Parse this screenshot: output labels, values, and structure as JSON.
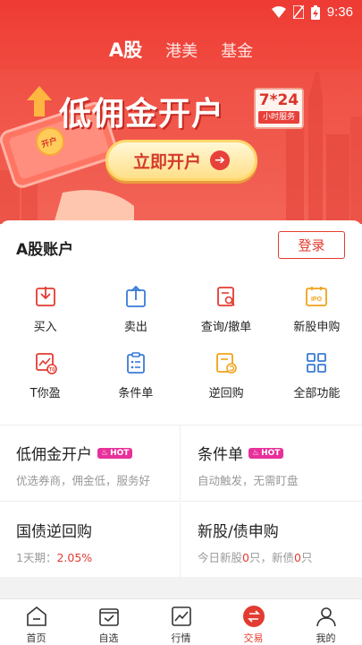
{
  "status": {
    "time": "9:36"
  },
  "market_tabs": [
    {
      "label": "A股",
      "active": true
    },
    {
      "label": "港美",
      "active": false
    },
    {
      "label": "基金",
      "active": false
    }
  ],
  "banner": {
    "title": "低佣金开户",
    "badge_big": "7*24",
    "badge_small": "小时服务",
    "cta": "立即开户",
    "phone_text": "开户"
  },
  "account": {
    "title": "A股账户",
    "login": "登录"
  },
  "functions": [
    {
      "label": "买入",
      "icon": "buy-icon"
    },
    {
      "label": "卖出",
      "icon": "sell-icon"
    },
    {
      "label": "查询/撤单",
      "icon": "query-icon"
    },
    {
      "label": "新股申购",
      "icon": "ipo-icon"
    },
    {
      "label": "T你盈",
      "icon": "t-profit-icon"
    },
    {
      "label": "条件单",
      "icon": "conditional-order-icon"
    },
    {
      "label": "逆回购",
      "icon": "reverse-repo-icon"
    },
    {
      "label": "全部功能",
      "icon": "all-functions-icon"
    }
  ],
  "cards": {
    "c1": {
      "title": "低佣金开户",
      "hot": "HOT",
      "sub": "优选券商，佣金低，服务好"
    },
    "c2": {
      "title": "条件单",
      "hot": "HOT",
      "sub": "自动触发，无需盯盘"
    },
    "c3": {
      "title": "国债逆回购",
      "sub_prefix": "1天期：",
      "sub_value": "2.05%"
    },
    "c4": {
      "title": "新股/债申购",
      "sub_a": "今日新股",
      "sub_a_num": "0",
      "sub_b": "只，新债",
      "sub_b_num": "0",
      "sub_c": "只"
    }
  },
  "tabbar": [
    {
      "label": "首页",
      "active": false
    },
    {
      "label": "自选",
      "active": false
    },
    {
      "label": "行情",
      "active": false
    },
    {
      "label": "交易",
      "active": true
    },
    {
      "label": "我的",
      "active": false
    }
  ],
  "colors": {
    "brand_red": "#e33b31",
    "hot_pink": "#e8309a",
    "cta_yellow": "#ffe08a",
    "icon_blue": "#3a7bd5",
    "icon_orange": "#f0a21a"
  }
}
